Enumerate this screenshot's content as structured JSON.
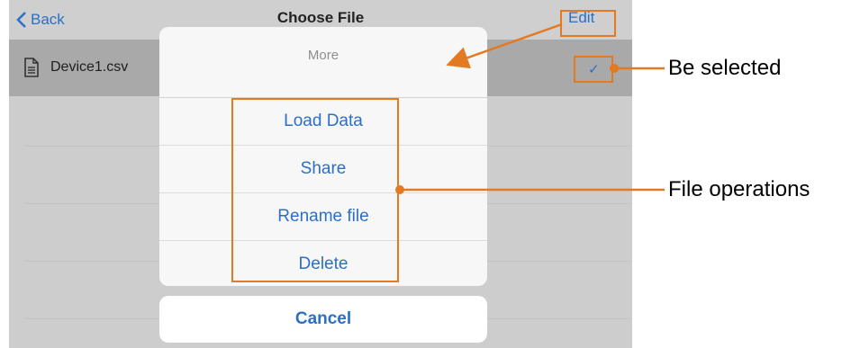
{
  "navbar": {
    "back_label": "Back",
    "title": "Choose File",
    "edit_label": "Edit"
  },
  "file_list": {
    "selected_file": "Device1.csv"
  },
  "action_sheet": {
    "header": "More",
    "items": [
      {
        "label": "Load Data"
      },
      {
        "label": "Share"
      },
      {
        "label": "Rename file"
      },
      {
        "label": "Delete"
      }
    ],
    "cancel_label": "Cancel"
  },
  "annotations": {
    "selected_label": "Be selected",
    "operations_label": "File operations",
    "color": "#e37a22"
  },
  "colors": {
    "accent": "#2c6fc7",
    "annotation": "#e37a22"
  }
}
